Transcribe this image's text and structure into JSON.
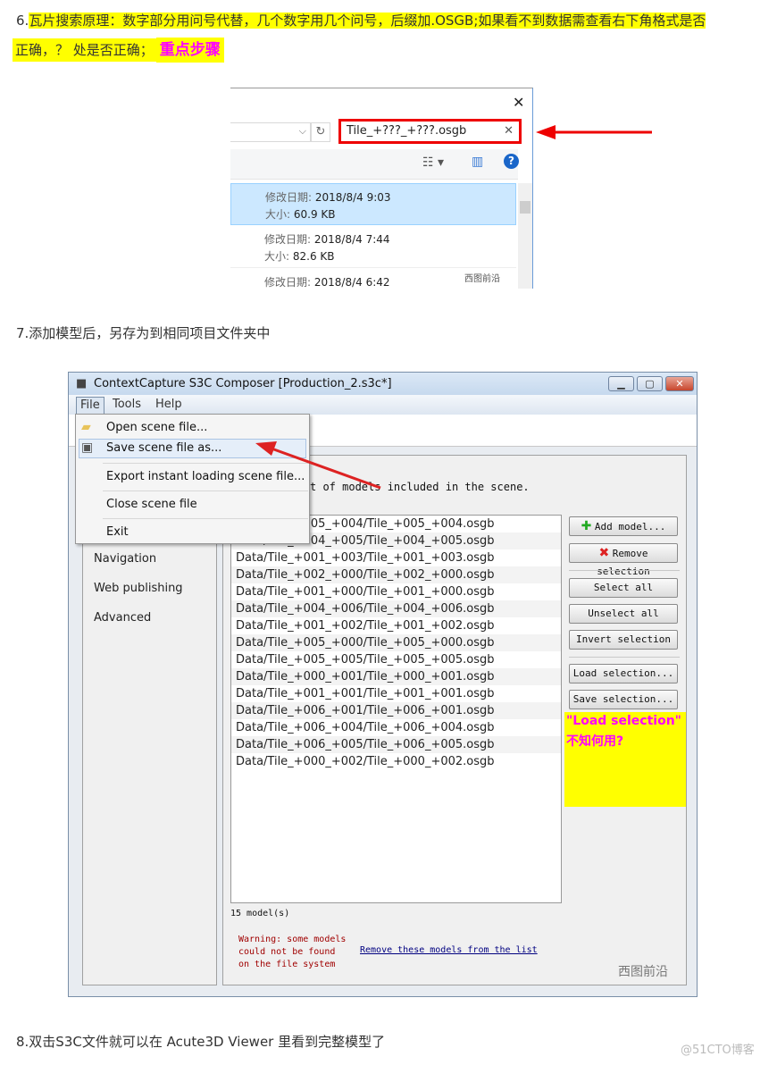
{
  "step6": {
    "text": "6.",
    "highlight_line1": "瓦片搜索原理：数字部分用问号代替，几个数字用几个问号，后缀加.OSGB;如果看不到数据需查看右下角格式是否",
    "highlight_line2": "正确，？ 处是否正确；",
    "emphasis": "重点步骤"
  },
  "explorer": {
    "search_value": "Tile_+???_+???.osgb",
    "files": [
      {
        "date_label": "修改日期:",
        "date": "2018/8/4 9:03",
        "size_label": "大小:",
        "size": "60.9 KB",
        "selected": true
      },
      {
        "date_label": "修改日期:",
        "date": "2018/8/4 7:44",
        "size_label": "大小:",
        "size": "82.6 KB",
        "selected": false
      },
      {
        "date_label": "修改日期:",
        "date": "2018/8/4 6:42"
      }
    ],
    "watermark": "西图前沿"
  },
  "step7": "7.添加模型后，另存为到相同项目文件夹中",
  "app": {
    "title": "ContextCapture S3C Composer [Production_2.s3c*]",
    "menus": [
      "File",
      "Tools",
      "Help"
    ],
    "file_menu": [
      "Open scene file...",
      "Save scene file as...",
      "Export instant loading scene file...",
      "Close scene file",
      "Exit"
    ],
    "sidebar": [
      "Navigation",
      "Web publishing",
      "Advanced"
    ],
    "description": "t of models included in the scene.",
    "models": [
      "Data/Tile_+005_+004/Tile_+005_+004.osgb",
      "Data/Tile_+004_+005/Tile_+004_+005.osgb",
      "Data/Tile_+001_+003/Tile_+001_+003.osgb",
      "Data/Tile_+002_+000/Tile_+002_+000.osgb",
      "Data/Tile_+001_+000/Tile_+001_+000.osgb",
      "Data/Tile_+004_+006/Tile_+004_+006.osgb",
      "Data/Tile_+001_+002/Tile_+001_+002.osgb",
      "Data/Tile_+005_+000/Tile_+005_+000.osgb",
      "Data/Tile_+005_+005/Tile_+005_+005.osgb",
      "Data/Tile_+000_+001/Tile_+000_+001.osgb",
      "Data/Tile_+001_+001/Tile_+001_+001.osgb",
      "Data/Tile_+006_+001/Tile_+006_+001.osgb",
      "Data/Tile_+006_+004/Tile_+006_+004.osgb",
      "Data/Tile_+006_+005/Tile_+006_+005.osgb",
      "Data/Tile_+000_+002/Tile_+000_+002.osgb"
    ],
    "buttons": {
      "add": "Add model...",
      "remove": "Remove selection",
      "select_all": "Select all",
      "unselect_all": "Unselect all",
      "invert": "Invert selection",
      "load": "Load selection...",
      "save": "Save selection..."
    },
    "note_line1": "\"Load selection\"",
    "note_line2": "不知何用?",
    "count": "15 model(s)",
    "warning": [
      "Warning: some models",
      "could not be found",
      "on the file system"
    ],
    "remove_link": "Remove these models from the list",
    "watermark": "西图前沿"
  },
  "step8": "8.双击S3C文件就可以在 Acute3D Viewer 里看到完整模型了",
  "site_watermark": "@51CTO博客",
  "colors": {
    "highlight": "#ffff00",
    "emphasis": "#ff00ff",
    "annotation_red": "#e00000",
    "warning": "#a00000",
    "link": "#000080"
  }
}
